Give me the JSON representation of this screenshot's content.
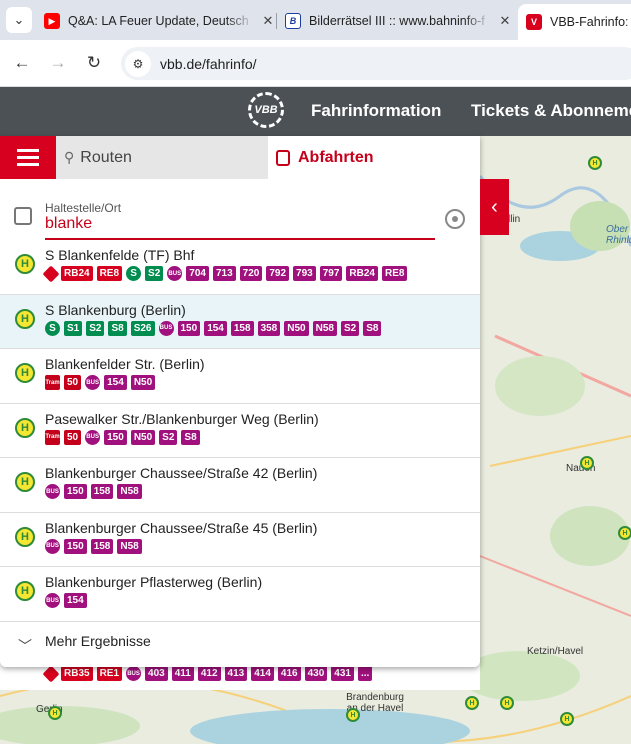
{
  "browser": {
    "tabs": [
      {
        "title": "Q&A: LA Feuer Update, Deutsch",
        "favicon": "youtube-icon"
      },
      {
        "title": "Bilderrätsel III :: www.bahninfo-f",
        "favicon": "bahninfo-icon"
      },
      {
        "title": "VBB-Fahrinfo: Ih",
        "favicon": "vbb-icon"
      }
    ],
    "url": "vbb.de/fahrinfo/"
  },
  "site_header": {
    "logo": "VBB",
    "nav": [
      "Fahrinformation",
      "Tickets & Abonneme"
    ]
  },
  "planner": {
    "tabs": {
      "routen": "Routen",
      "abfahrten": "Abfahrten"
    },
    "field_label": "Haltestelle/Ort",
    "field_value": "blanke"
  },
  "results": [
    {
      "name": "S Blankenfelde (TF) Bhf",
      "lines": [
        {
          "m": "db"
        },
        {
          "t": "RB24",
          "c": "re"
        },
        {
          "t": "RE8",
          "c": "re"
        },
        {
          "m": "s"
        },
        {
          "t": "S2",
          "c": "s"
        },
        {
          "m": "bus"
        },
        {
          "t": "704",
          "c": "bus"
        },
        {
          "t": "713",
          "c": "bus"
        },
        {
          "t": "720",
          "c": "bus"
        },
        {
          "t": "792",
          "c": "bus"
        },
        {
          "t": "793",
          "c": "bus"
        },
        {
          "t": "797",
          "c": "bus"
        },
        {
          "t": "RB24",
          "c": "bus"
        },
        {
          "t": "RE8",
          "c": "bus"
        }
      ]
    },
    {
      "name": "S Blankenburg (Berlin)",
      "highlight": true,
      "lines": [
        {
          "m": "s"
        },
        {
          "t": "S1",
          "c": "s"
        },
        {
          "t": "S2",
          "c": "s"
        },
        {
          "t": "S8",
          "c": "s"
        },
        {
          "t": "S26",
          "c": "s"
        },
        {
          "m": "bus"
        },
        {
          "t": "150",
          "c": "bus"
        },
        {
          "t": "154",
          "c": "bus"
        },
        {
          "t": "158",
          "c": "bus"
        },
        {
          "t": "358",
          "c": "bus"
        },
        {
          "t": "N50",
          "c": "bus"
        },
        {
          "t": "N58",
          "c": "bus"
        },
        {
          "t": "S2",
          "c": "bus"
        },
        {
          "t": "S8",
          "c": "bus"
        }
      ]
    },
    {
      "name": "Blankenfelder Str. (Berlin)",
      "lines": [
        {
          "m": "tram"
        },
        {
          "t": "50",
          "c": "tram"
        },
        {
          "m": "bus"
        },
        {
          "t": "154",
          "c": "bus"
        },
        {
          "t": "N50",
          "c": "bus"
        }
      ]
    },
    {
      "name": "Pasewalker Str./Blankenburger Weg (Berlin)",
      "lines": [
        {
          "m": "tram"
        },
        {
          "t": "50",
          "c": "tram"
        },
        {
          "m": "bus"
        },
        {
          "t": "150",
          "c": "bus"
        },
        {
          "t": "N50",
          "c": "bus"
        },
        {
          "t": "S2",
          "c": "bus"
        },
        {
          "t": "S8",
          "c": "bus"
        }
      ]
    },
    {
      "name": "Blankenburger Chaussee/Straße 42 (Berlin)",
      "lines": [
        {
          "m": "bus"
        },
        {
          "t": "150",
          "c": "bus"
        },
        {
          "t": "158",
          "c": "bus"
        },
        {
          "t": "N58",
          "c": "bus"
        }
      ]
    },
    {
      "name": "Blankenburger Chaussee/Straße 45 (Berlin)",
      "lines": [
        {
          "m": "bus"
        },
        {
          "t": "150",
          "c": "bus"
        },
        {
          "t": "158",
          "c": "bus"
        },
        {
          "t": "N58",
          "c": "bus"
        }
      ]
    },
    {
      "name": "Blankenburger Pflasterweg (Berlin)",
      "lines": [
        {
          "m": "bus"
        },
        {
          "t": "154",
          "c": "bus"
        }
      ]
    }
  ],
  "more_results": "Mehr Ergebnisse",
  "under_row_lines": [
    {
      "m": "db"
    },
    {
      "t": "RB35",
      "c": "re"
    },
    {
      "t": "RE1",
      "c": "re"
    },
    {
      "m": "bus"
    },
    {
      "t": "403",
      "c": "bus"
    },
    {
      "t": "411",
      "c": "bus"
    },
    {
      "t": "412",
      "c": "bus"
    },
    {
      "t": "413",
      "c": "bus"
    },
    {
      "t": "414",
      "c": "bus"
    },
    {
      "t": "416",
      "c": "bus"
    },
    {
      "t": "430",
      "c": "bus"
    },
    {
      "t": "431",
      "c": "bus"
    },
    {
      "t": "...",
      "c": "bus"
    }
  ],
  "map_labels": [
    "llin",
    "Ober Rhinlu",
    "Nauen",
    "Ketzin/Havel",
    "Brandenburg an der Havel",
    "Gerlin"
  ],
  "mode_labels": {
    "db": "Bahn",
    "s": "S",
    "bus": "BUS",
    "tram": "Tram"
  },
  "stop_letter": "H"
}
